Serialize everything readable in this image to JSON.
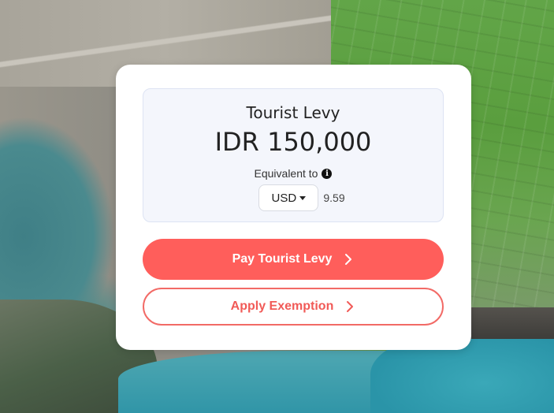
{
  "levy": {
    "title": "Tourist Levy",
    "amount": "IDR 150,000",
    "equivalent_label": "Equivalent to",
    "currency": "USD",
    "converted_value": "9.59"
  },
  "actions": {
    "pay_label": "Pay Tourist Levy",
    "exemption_label": "Apply Exemption"
  },
  "icons": {
    "info": "info-icon",
    "caret": "caret-down-icon",
    "chevron": "chevron-right-icon"
  },
  "colors": {
    "primary": "#ff5e5b",
    "box_bg": "#f4f6fc"
  }
}
